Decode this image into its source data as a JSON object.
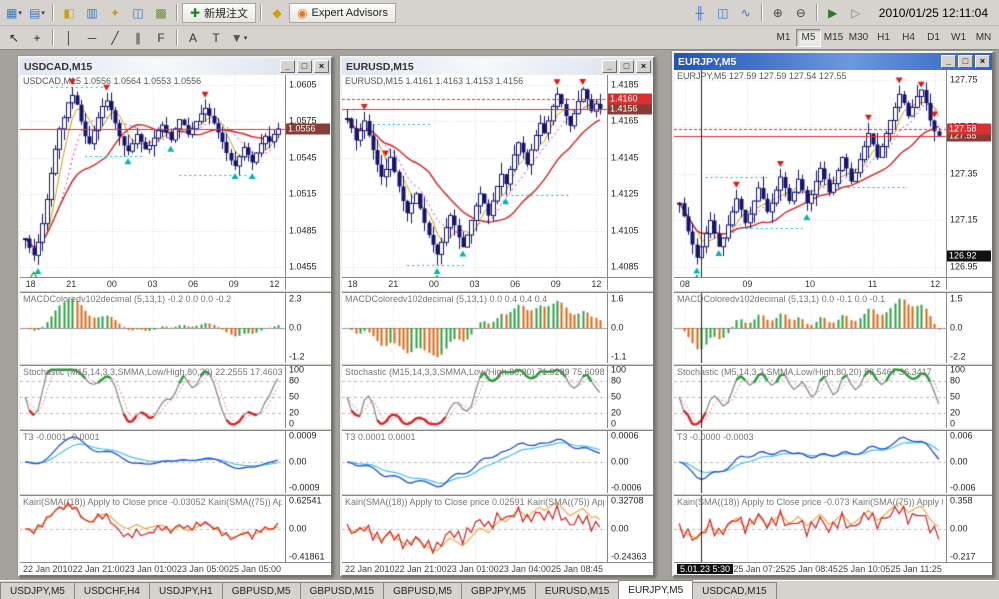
{
  "app": {
    "datetime": "2010/01/25 12:11:04"
  },
  "chrome": {
    "minimize": "_",
    "maximize": "□",
    "close": "×"
  },
  "toolbar": {
    "left_icons": [
      {
        "name": "new-chart-icon",
        "glyph": "▦",
        "color": "#3a7abf",
        "dropdown": true
      },
      {
        "name": "profiles-icon",
        "glyph": "▤",
        "color": "#3a7abf",
        "dropdown": true
      },
      {
        "name": "sep"
      },
      {
        "name": "market-watch-icon",
        "glyph": "◧",
        "color": "#caa017"
      },
      {
        "name": "data-window-icon",
        "glyph": "▥",
        "color": "#3a7abf"
      },
      {
        "name": "navigator-icon",
        "glyph": "✦",
        "color": "#caa017"
      },
      {
        "name": "terminal-icon",
        "glyph": "◫",
        "color": "#3a7abf"
      },
      {
        "name": "strategy-tester-icon",
        "glyph": "▩",
        "color": "#6a8a3a"
      },
      {
        "name": "sep"
      },
      {
        "name": "new-order-button",
        "glyph": "✚",
        "color": "#1a8a1a",
        "label": "新規注文"
      },
      {
        "name": "sep"
      },
      {
        "name": "metaeditor-icon",
        "glyph": "◆",
        "color": "#d0a000"
      },
      {
        "name": "expert-advisors-button",
        "glyph": "◉",
        "color": "#e07820",
        "label": "Expert Advisors"
      }
    ],
    "right_icons": [
      {
        "name": "bar-chart-icon",
        "glyph": "╫",
        "color": "#3a6fbf"
      },
      {
        "name": "candlestick-chart-icon",
        "glyph": "◫",
        "color": "#3a6fbf"
      },
      {
        "name": "line-chart-icon",
        "glyph": "∿",
        "color": "#3a6fbf"
      },
      {
        "name": "sep"
      },
      {
        "name": "zoom-in-icon",
        "glyph": "⊕",
        "color": "#444"
      },
      {
        "name": "zoom-out-icon",
        "glyph": "⊖",
        "color": "#444"
      },
      {
        "name": "sep"
      },
      {
        "name": "auto-scroll-icon",
        "glyph": "▶",
        "color": "#2a7a2a"
      },
      {
        "name": "chart-shift-icon",
        "glyph": "▷",
        "color": "#888"
      }
    ]
  },
  "toolbar2": {
    "left_icons": [
      {
        "name": "cursor-icon",
        "glyph": "↖",
        "color": "#222"
      },
      {
        "name": "crosshair-icon",
        "glyph": "+",
        "color": "#222"
      },
      {
        "name": "sep"
      },
      {
        "name": "vertical-line-icon",
        "glyph": "│",
        "color": "#333"
      },
      {
        "name": "horizontal-line-icon",
        "glyph": "─",
        "color": "#333"
      },
      {
        "name": "trendline-icon",
        "glyph": "╱",
        "color": "#333"
      },
      {
        "name": "channel-icon",
        "glyph": "∥",
        "color": "#333"
      },
      {
        "name": "fibonacci-icon",
        "glyph": "F",
        "color": "#333"
      },
      {
        "name": "sep"
      },
      {
        "name": "text-icon",
        "glyph": "A",
        "color": "#333"
      },
      {
        "name": "text-label-icon",
        "glyph": "T",
        "color": "#333"
      },
      {
        "name": "arrows-icon",
        "glyph": "▼",
        "color": "#555",
        "dropdown": true
      }
    ],
    "timeframes": [
      "M1",
      "M5",
      "M15",
      "M30",
      "H1",
      "H4",
      "D1",
      "W1",
      "MN"
    ],
    "active_timeframe": "M5"
  },
  "charts": [
    {
      "title": "USDCAD,M15",
      "active": false,
      "info": "USDCAD,M15 1.0556 1.0564 1.0553 1.0556",
      "price_ticks": [
        "1.0605",
        "1.0575",
        "1.0545",
        "1.0515",
        "1.0485",
        "1.0455"
      ],
      "bid": "1.0556",
      "ask": null,
      "time_ticks": [
        "18",
        "21",
        "00",
        "03",
        "06",
        "09",
        "12"
      ],
      "macd": {
        "label": "MACDColoredv102decimal (5,13,1) -0.2 0.0 0.0 -0.2",
        "ticks": [
          "2.3",
          "0.0",
          "-1.2"
        ]
      },
      "stoch": {
        "label": "Stochastic (M15,14,3,3,SMMA,Low/High,80,20) 22.2555 17.4603",
        "ticks": [
          "100",
          "80",
          "50",
          "20",
          "0"
        ]
      },
      "t3": {
        "label": "T3 -0.0001 -0.0001",
        "ticks": [
          "0.0009",
          "0.00",
          "-0.0009"
        ]
      },
      "kairi": {
        "label": "Kairi(SMA((18)) Apply to Close price -0.03052 Kairi(SMA((75)) Apply",
        "ticks": [
          "0.62541",
          "0.00",
          "-0.41861"
        ]
      },
      "date_labels": [
        "22 Jan 2010",
        "22 Jan 21:00",
        "23 Jan 01:00",
        "23 Jan 05:00",
        "25 Jan 05:00"
      ],
      "readout_first": false,
      "closes": [
        1.0497,
        1.0492,
        1.0488,
        1.0495,
        1.0505,
        1.0518,
        1.0532,
        1.0545,
        1.0556,
        1.0562,
        1.057,
        1.0574,
        1.0569,
        1.056,
        1.0552,
        1.0548,
        1.0555,
        1.0562,
        1.0568,
        1.0571,
        1.0566,
        1.0559,
        1.0552,
        1.0547,
        1.0544,
        1.0548,
        1.0553,
        1.0549,
        1.0545,
        1.0547,
        1.0551,
        1.0555,
        1.0558,
        1.0554,
        1.055,
        1.0556,
        1.0561,
        1.0558,
        1.0553,
        1.0556,
        1.056,
        1.0564,
        1.0567,
        1.0563,
        1.0559,
        1.0554,
        1.0549,
        1.0543,
        1.0539,
        1.0536,
        1.0541,
        1.0546,
        1.0542,
        1.0538,
        1.0543,
        1.0548,
        1.0552,
        1.0549,
        1.0553,
        1.0556
      ],
      "arrows": [
        {
          "i": 2,
          "t": "green-up"
        },
        {
          "i": 3,
          "t": "cyan-up"
        },
        {
          "i": 11,
          "t": "red-down"
        },
        {
          "i": 19,
          "t": "red-down"
        },
        {
          "i": 24,
          "t": "cyan-up"
        },
        {
          "i": 34,
          "t": "cyan-up"
        },
        {
          "i": 42,
          "t": "red-down"
        },
        {
          "i": 49,
          "t": "cyan-up"
        },
        {
          "i": 53,
          "t": "cyan-up"
        }
      ]
    },
    {
      "title": "EURUSD,M15",
      "active": false,
      "info": "EURUSD,M15 1.4161 1.4163 1.4153 1.4156",
      "price_ticks": [
        "1.4185",
        "1.4165",
        "1.4145",
        "1.4125",
        "1.4105",
        "1.4085"
      ],
      "bid": "1.4156",
      "ask": "1.4160",
      "time_ticks": [
        "18",
        "21",
        "00",
        "03",
        "06",
        "09",
        "12"
      ],
      "macd": {
        "label": "MACDColoredv102decimal (5,13,1) 0.0 0.4 0.4 0.4",
        "ticks": [
          "1.6",
          "0.0",
          "-1.1"
        ]
      },
      "stoch": {
        "label": "Stochastic (M15,14,3,3,SMMA,Low/High,80,20) 71.9289 75.6098",
        "ticks": [
          "100",
          "80",
          "50",
          "20",
          "0"
        ]
      },
      "t3": {
        "label": "T3 0.0001 0.0001",
        "ticks": [
          "0.0006",
          "0.00",
          "-0.0006"
        ]
      },
      "kairi": {
        "label": "Kairi(SMA((18)) Apply to Close price 0.02591 Kairi(SMA((75)) Apply to Clo",
        "ticks": [
          "0.32708",
          "0.00",
          "-0.24363"
        ]
      },
      "date_labels": [
        "22 Jan 2010",
        "22 Jan 21:00",
        "23 Jan 01:00",
        "23 Jan 04:00",
        "25 Jan 08:45"
      ],
      "readout_first": false,
      "closes": [
        1.4152,
        1.4148,
        1.4143,
        1.4147,
        1.4151,
        1.4145,
        1.4139,
        1.4133,
        1.4128,
        1.4131,
        1.4136,
        1.413,
        1.4124,
        1.4118,
        1.4113,
        1.4117,
        1.4121,
        1.4115,
        1.4109,
        1.4104,
        1.41,
        1.4096,
        1.4101,
        1.4107,
        1.4112,
        1.4108,
        1.4103,
        1.4099,
        1.4104,
        1.411,
        1.4116,
        1.4121,
        1.4117,
        1.4112,
        1.4118,
        1.4124,
        1.4129,
        1.4125,
        1.4131,
        1.4137,
        1.4142,
        1.4138,
        1.4133,
        1.4139,
        1.4145,
        1.415,
        1.4146,
        1.4151,
        1.4157,
        1.4162,
        1.4158,
        1.4153,
        1.4149,
        1.4154,
        1.4159,
        1.4164,
        1.416,
        1.4155,
        1.4158,
        1.4156
      ],
      "arrows": [
        {
          "i": 4,
          "t": "red-down"
        },
        {
          "i": 9,
          "t": "red-down"
        },
        {
          "i": 21,
          "t": "green-up"
        },
        {
          "i": 21,
          "t": "cyan-up"
        },
        {
          "i": 27,
          "t": "cyan-up"
        },
        {
          "i": 37,
          "t": "cyan-up"
        },
        {
          "i": 49,
          "t": "red-down"
        },
        {
          "i": 55,
          "t": "red-down"
        }
      ]
    },
    {
      "title": "EURJPY,M5",
      "active": true,
      "info": "EURJPY,M5 127.59 127.59 127.54 127.55",
      "price_ticks": [
        "127.75",
        "127.55",
        "127.35",
        "127.15",
        "126.95"
      ],
      "bid": "127.55",
      "ask": "127.58",
      "crosshair_price": "126.92",
      "crosshair_frac": 0.1,
      "time_ticks": [
        "08",
        "09",
        "10",
        "11",
        "12"
      ],
      "macd": {
        "label": "MACDColoredv102decimal (5,13,1) 0.0 -0.1 0.0 -0.1",
        "ticks": [
          "1.5",
          "0.0",
          "-2.2"
        ]
      },
      "stoch": {
        "label": "Stochastic (M5,14,3,3,SMMA,Low/High,80,20) 58.5467 36.3417",
        "ticks": [
          "100",
          "80",
          "50",
          "20",
          "0"
        ]
      },
      "t3": {
        "label": "T3 -0.0000 -0.0003",
        "ticks": [
          "0.006",
          "0.00",
          "-0.006"
        ]
      },
      "kairi": {
        "label": "Kairi(SMA((18)) Apply to Close price -0.073 Kairi(SMA((75)) Apply to C",
        "ticks": [
          "0.358",
          "0.00",
          "-0.217"
        ]
      },
      "date_labels": [
        "5.01.23 5:30",
        "25 Jan 07:25",
        "25 Jan 08:45",
        "25 Jan 10:05",
        "25 Jan 11:25"
      ],
      "readout_first": true,
      "closes": [
        127.24,
        127.18,
        127.11,
        127.05,
        126.99,
        127.04,
        127.1,
        127.16,
        127.1,
        127.04,
        127.08,
        127.14,
        127.2,
        127.26,
        127.21,
        127.15,
        127.19,
        127.25,
        127.31,
        127.26,
        127.2,
        127.24,
        127.3,
        127.36,
        127.31,
        127.25,
        127.29,
        127.35,
        127.3,
        127.24,
        127.28,
        127.34,
        127.4,
        127.35,
        127.29,
        127.33,
        127.39,
        127.45,
        127.4,
        127.34,
        127.38,
        127.44,
        127.5,
        127.56,
        127.51,
        127.45,
        127.5,
        127.56,
        127.62,
        127.68,
        127.74,
        127.7,
        127.64,
        127.68,
        127.73,
        127.76,
        127.7,
        127.62,
        127.57,
        127.55
      ],
      "arrows": [
        {
          "i": 4,
          "t": "green-up"
        },
        {
          "i": 4,
          "t": "cyan-up"
        },
        {
          "i": 9,
          "t": "cyan-up"
        },
        {
          "i": 13,
          "t": "red-down"
        },
        {
          "i": 23,
          "t": "red-down"
        },
        {
          "i": 29,
          "t": "cyan-up"
        },
        {
          "i": 43,
          "t": "red-down"
        },
        {
          "i": 50,
          "t": "red-down"
        },
        {
          "i": 55,
          "t": "red-down"
        },
        {
          "i": 58,
          "t": "red-down"
        }
      ]
    }
  ],
  "tabs": {
    "items": [
      "USDJPY,M5",
      "USDCHF,H4",
      "USDJPY,H1",
      "GBPUSD,M5",
      "GBPUSD,M15",
      "GBPUSD,M5",
      "GBPJPY,M5",
      "EURUSD,M15",
      "EURJPY,M5",
      "USDCAD,M15"
    ],
    "active_index": 8
  }
}
